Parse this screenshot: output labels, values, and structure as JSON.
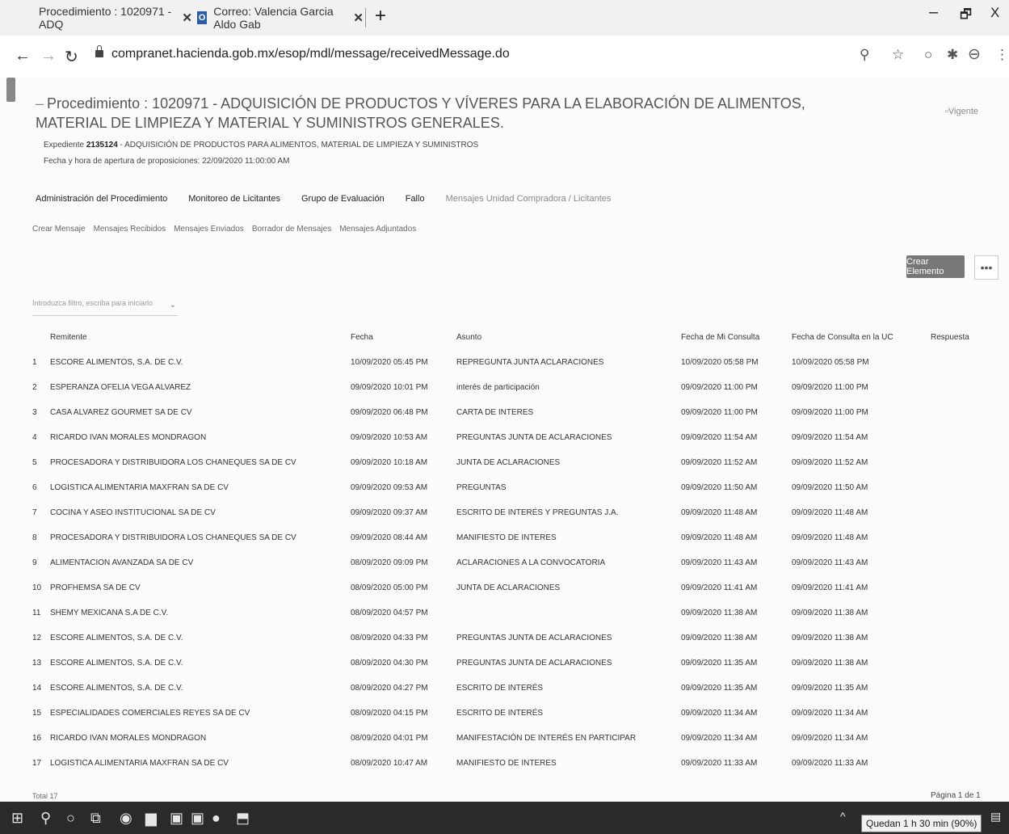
{
  "browser": {
    "tabs": [
      {
        "label": "Procedimiento : 1020971 - ADQ"
      },
      {
        "label": "Correo: Valencia Garcia Aldo Gab"
      }
    ],
    "url": "compranet.hacienda.gob.mx/esop/mdl/message/receivedMessage.do",
    "window_controls": {
      "minimize": "–",
      "restore": "🗗",
      "close": "X"
    }
  },
  "procedure": {
    "title": "Procedimiento : 1020971 - ADQUISICIÓN DE PRODUCTOS Y VÍVERES PARA LA ELABORACIÓN DE ALIMENTOS, MATERIAL DE LIMPIEZA Y MATERIAL Y SUMINISTROS GENERALES.",
    "status": "Vigente",
    "expediente_label": "Expediente",
    "expediente_number": "2135124",
    "expediente_desc": "- ADQUISICIÓN DE PRODUCTOS PARA ALIMENTOS, MATERIAL DE LIMPIEZA Y SUMINISTROS",
    "apertura_label": "Fecha y hora de apertura de proposiciones:",
    "apertura_value": "22/09/2020 11:00:00 AM"
  },
  "main_nav": [
    "Administración del Procedimiento",
    "Monitoreo de Licitantes",
    "Grupo de Evaluación",
    "Fallo",
    "Mensajes Unidad Compradora / Licitantes"
  ],
  "sub_nav": [
    "Crear Mensaje",
    "Mensajes Recibidos",
    "Mensajes Enviados",
    "Borrador de Mensajes",
    "Mensajes Adjuntados"
  ],
  "actions": {
    "create_label": "Crear Elemento",
    "more_label": "•••"
  },
  "filter": {
    "placeholder": "Introduzca filtro, escriba para iniciarlo"
  },
  "table": {
    "headers": {
      "remitente": "Remitente",
      "fecha": "Fecha",
      "asunto": "Asunto",
      "mi_consulta": "Fecha de Mi Consulta",
      "consulta_uc": "Fecha de Consulta en la UC",
      "respuesta": "Respuesta"
    },
    "rows": [
      {
        "n": "1",
        "remitente": "ESCORE ALIMENTOS, S.A. DE C.V.",
        "fecha": "10/09/2020 05:45 PM",
        "asunto": "REPREGUNTA JUNTA ACLARACIONES",
        "mi": "10/09/2020 05:58 PM",
        "uc": "10/09/2020 05:58 PM"
      },
      {
        "n": "2",
        "remitente": "ESPERANZA OFELIA VEGA ALVAREZ",
        "fecha": "09/09/2020 10:01 PM",
        "asunto": "interés de participación",
        "mi": "09/09/2020 11:00 PM",
        "uc": "09/09/2020 11:00 PM"
      },
      {
        "n": "3",
        "remitente": "CASA ALVAREZ GOURMET SA DE CV",
        "fecha": "09/09/2020 06:48 PM",
        "asunto": "CARTA DE INTERES",
        "mi": "09/09/2020 11:00 PM",
        "uc": "09/09/2020 11:00 PM"
      },
      {
        "n": "4",
        "remitente": "RICARDO IVAN MORALES MONDRAGON",
        "fecha": "09/09/2020 10:53 AM",
        "asunto": "PREGUNTAS JUNTA DE ACLARACIONES",
        "mi": "09/09/2020 11:54 AM",
        "uc": "09/09/2020 11:54 AM"
      },
      {
        "n": "5",
        "remitente": "PROCESADORA Y DISTRIBUIDORA LOS CHANEQUES SA DE CV",
        "fecha": "09/09/2020 10:18 AM",
        "asunto": "JUNTA DE ACLARACIONES",
        "mi": "09/09/2020 11:52 AM",
        "uc": "09/09/2020 11:52 AM"
      },
      {
        "n": "6",
        "remitente": "LOGISTICA ALIMENTARIA MAXFRAN SA DE CV",
        "fecha": "09/09/2020 09:53 AM",
        "asunto": "PREGUNTAS",
        "mi": "09/09/2020 11:50 AM",
        "uc": "09/09/2020 11:50 AM"
      },
      {
        "n": "7",
        "remitente": "COCINA Y ASEO INSTITUCIONAL SA DE CV",
        "fecha": "09/09/2020 09:37 AM",
        "asunto": "ESCRITO DE INTERÉS Y PREGUNTAS J.A.",
        "mi": "09/09/2020 11:48 AM",
        "uc": "09/09/2020 11:48 AM"
      },
      {
        "n": "8",
        "remitente": "PROCESADORA Y DISTRIBUIDORA LOS CHANEQUES SA DE CV",
        "fecha": "09/09/2020 08:44 AM",
        "asunto": "MANIFIESTO DE INTERES",
        "mi": "09/09/2020 11:48 AM",
        "uc": "09/09/2020 11:48 AM"
      },
      {
        "n": "9",
        "remitente": "ALIMENTACION AVANZADA SA DE CV",
        "fecha": "08/09/2020 09:09 PM",
        "asunto": "ACLARACIONES A LA CONVOCATORIA",
        "mi": "09/09/2020 11:43 AM",
        "uc": "09/09/2020 11:43 AM"
      },
      {
        "n": "10",
        "remitente": "PROFHEMSA SA DE CV",
        "fecha": "08/09/2020 05:00 PM",
        "asunto": "JUNTA DE ACLARACIONES",
        "mi": "09/09/2020 11:41 AM",
        "uc": "09/09/2020 11:41 AM"
      },
      {
        "n": "11",
        "remitente": "SHEMY MEXICANA S.A DE C.V.",
        "fecha": "08/09/2020 04:57 PM",
        "asunto": "",
        "mi": "09/09/2020 11:38 AM",
        "uc": "09/09/2020 11:38 AM"
      },
      {
        "n": "12",
        "remitente": "ESCORE ALIMENTOS, S.A. DE C.V.",
        "fecha": "08/09/2020 04:33 PM",
        "asunto": "PREGUNTAS JUNTA DE ACLARACIONES",
        "mi": "09/09/2020 11:38 AM",
        "uc": "09/09/2020 11:38 AM"
      },
      {
        "n": "13",
        "remitente": "ESCORE ALIMENTOS, S.A. DE C.V.",
        "fecha": "08/09/2020 04:30 PM",
        "asunto": "PREGUNTAS JUNTA DE ACLARACIONES",
        "mi": "09/09/2020 11:35 AM",
        "uc": "09/09/2020 11:38 AM"
      },
      {
        "n": "14",
        "remitente": "ESCORE ALIMENTOS, S.A. DE C.V.",
        "fecha": "08/09/2020 04:27 PM",
        "asunto": "ESCRITO DE INTERÉS",
        "mi": "09/09/2020 11:35 AM",
        "uc": "09/09/2020 11:35 AM"
      },
      {
        "n": "15",
        "remitente": "ESPECIALIDADES COMERCIALES REYES SA DE CV",
        "fecha": "08/09/2020 04:15 PM",
        "asunto": "ESCRITO DE INTERÉS",
        "mi": "09/09/2020 11:34 AM",
        "uc": "09/09/2020 11:34 AM"
      },
      {
        "n": "16",
        "remitente": "RICARDO IVAN MORALES MONDRAGON",
        "fecha": "08/09/2020 04:01 PM",
        "asunto": "MANIFESTACIÓN DE INTERÉS EN PARTICIPAR",
        "mi": "09/09/2020 11:34 AM",
        "uc": "09/09/2020 11:34 AM"
      },
      {
        "n": "17",
        "remitente": "LOGISTICA ALIMENTARIA MAXFRAN SA DE CV",
        "fecha": "08/09/2020 10:47 AM",
        "asunto": "MANIFIESTO DE INTERES",
        "mi": "09/09/2020 11:33 AM",
        "uc": "09/09/2020 11:33 AM"
      }
    ],
    "total": "Total 17",
    "pagination": "Página 1 de 1"
  },
  "taskbar": {
    "battery_tooltip": "Quedan 1 h 30 min (90%)"
  }
}
